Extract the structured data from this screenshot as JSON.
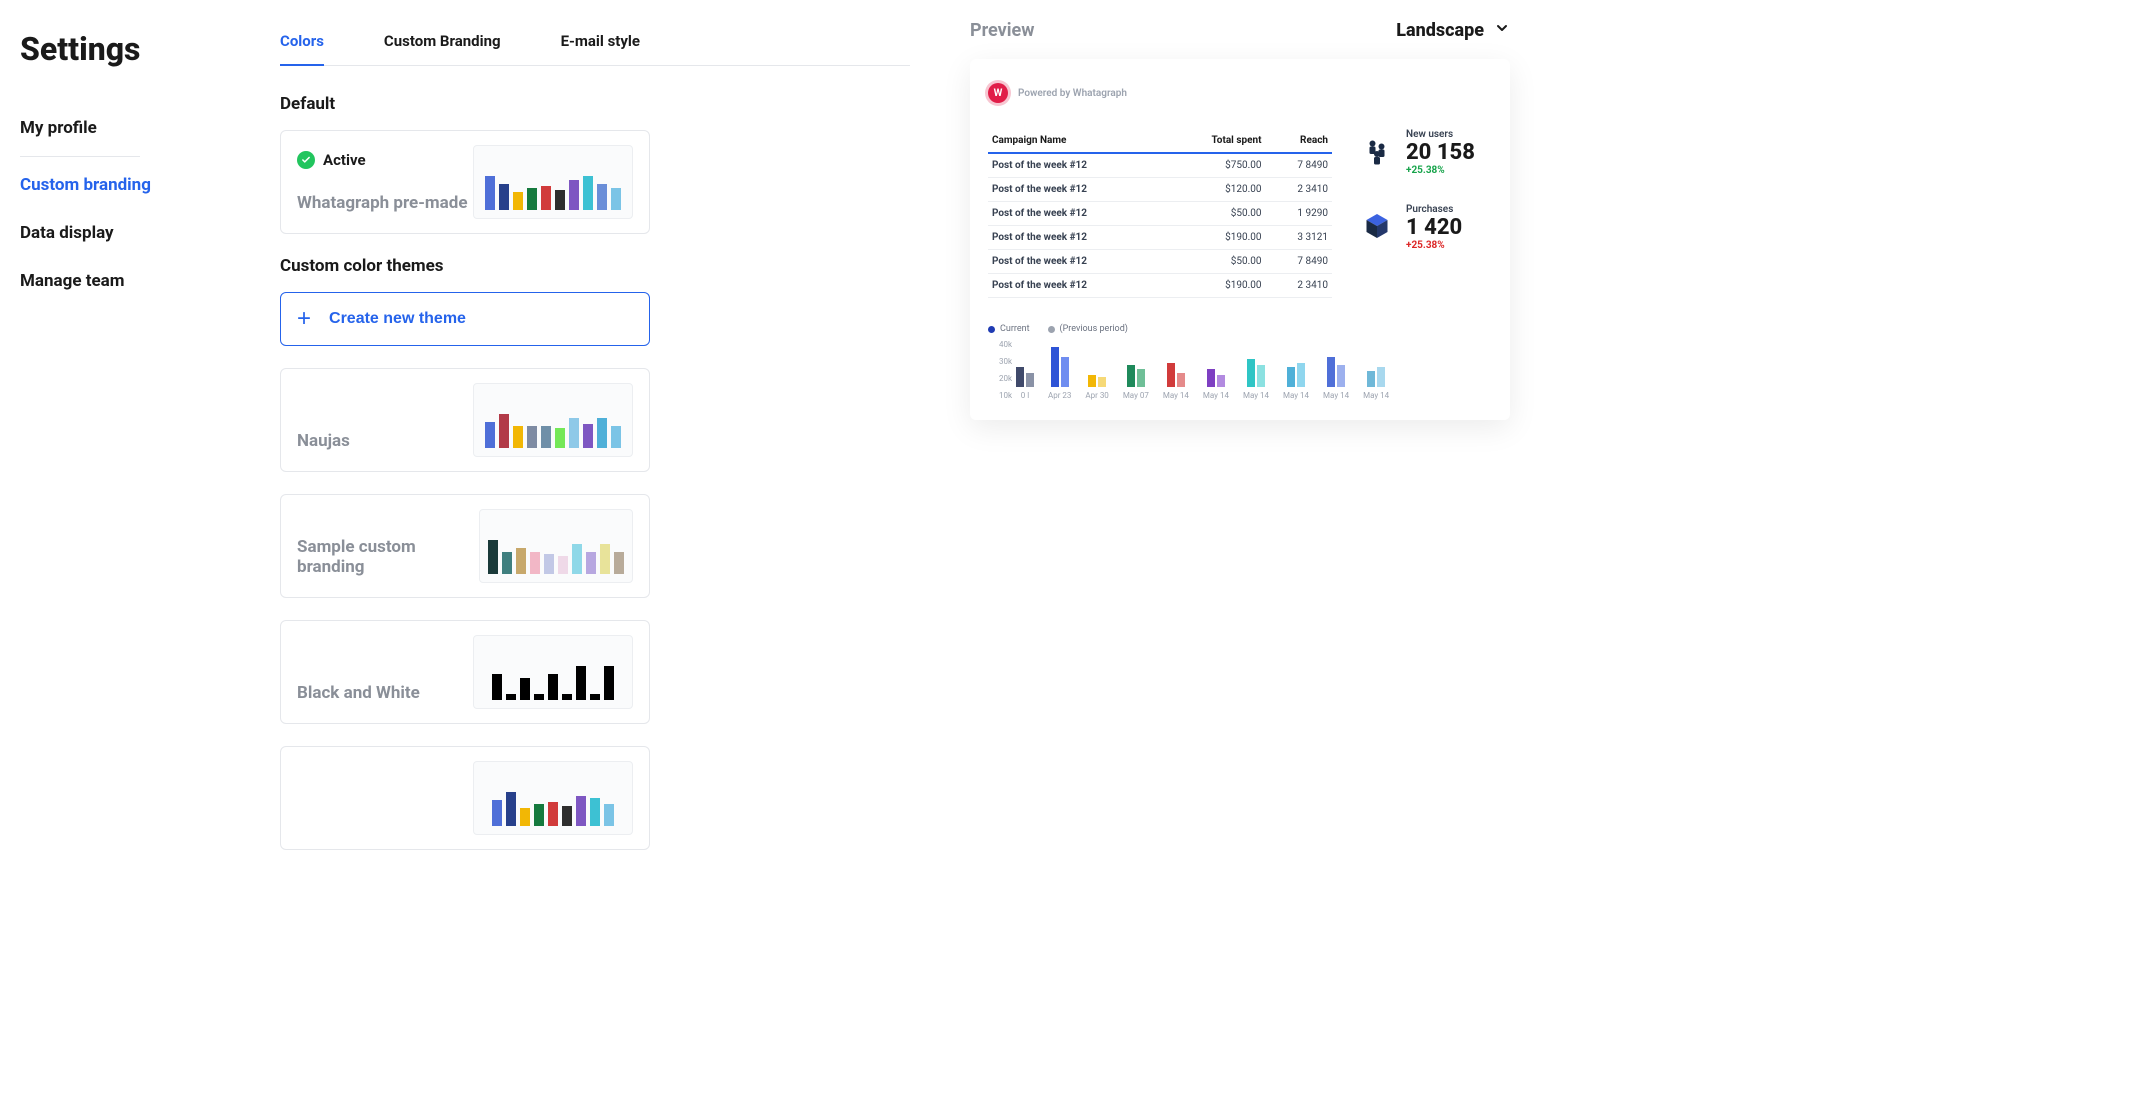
{
  "page_title": "Settings",
  "sidebar": {
    "items": [
      {
        "label": "My profile",
        "active": false
      },
      {
        "label": "Custom branding",
        "active": true
      },
      {
        "label": "Data display",
        "active": false
      },
      {
        "label": "Manage team",
        "active": false
      }
    ]
  },
  "tabs": [
    {
      "label": "Colors",
      "active": true
    },
    {
      "label": "Custom Branding",
      "active": false
    },
    {
      "label": "E-mail style",
      "active": false
    }
  ],
  "default_section_label": "Default",
  "active_badge_label": "Active",
  "default_theme": {
    "name": "Whatagraph pre-made",
    "is_active": true,
    "bars": [
      {
        "h": 34,
        "c": "#4f6fd8"
      },
      {
        "h": 26,
        "c": "#27408b"
      },
      {
        "h": 18,
        "c": "#f2b705"
      },
      {
        "h": 22,
        "c": "#157a3e"
      },
      {
        "h": 24,
        "c": "#d13b3b"
      },
      {
        "h": 20,
        "c": "#2e2e2e"
      },
      {
        "h": 30,
        "c": "#7e57c2"
      },
      {
        "h": 34,
        "c": "#3dc1d3"
      },
      {
        "h": 26,
        "c": "#6a8ed8"
      },
      {
        "h": 22,
        "c": "#7bc4e6"
      }
    ]
  },
  "custom_section_label": "Custom color themes",
  "create_btn_label": "Create new theme",
  "custom_themes": [
    {
      "name": "Naujas",
      "bars": [
        {
          "h": 26,
          "c": "#4f6fd8"
        },
        {
          "h": 34,
          "c": "#b23a48"
        },
        {
          "h": 22,
          "c": "#f2b705"
        },
        {
          "h": 22,
          "c": "#7e8ba3"
        },
        {
          "h": 22,
          "c": "#6f8fa8"
        },
        {
          "h": 20,
          "c": "#74e858"
        },
        {
          "h": 30,
          "c": "#8ec9e8"
        },
        {
          "h": 24,
          "c": "#7e57c2"
        },
        {
          "h": 30,
          "c": "#4fb0d8"
        },
        {
          "h": 22,
          "c": "#7bc4e6"
        }
      ]
    },
    {
      "name": "Sample custom branding",
      "bars": [
        {
          "h": 34,
          "c": "#1a3a3a"
        },
        {
          "h": 22,
          "c": "#3f7f7f"
        },
        {
          "h": 26,
          "c": "#c7a86b"
        },
        {
          "h": 22,
          "c": "#f2b7c6"
        },
        {
          "h": 20,
          "c": "#c2c8e6"
        },
        {
          "h": 18,
          "c": "#efd9e8"
        },
        {
          "h": 30,
          "c": "#8fd8e8"
        },
        {
          "h": 22,
          "c": "#b7a7e0"
        },
        {
          "h": 30,
          "c": "#e8e39a"
        },
        {
          "h": 22,
          "c": "#b8ab9a"
        }
      ]
    },
    {
      "name": "Black and White",
      "bars": [
        {
          "h": 26,
          "c": "#000000"
        },
        {
          "h": 6,
          "c": "#000000"
        },
        {
          "h": 22,
          "c": "#000000"
        },
        {
          "h": 6,
          "c": "#000000"
        },
        {
          "h": 26,
          "c": "#000000"
        },
        {
          "h": 6,
          "c": "#000000"
        },
        {
          "h": 34,
          "c": "#000000"
        },
        {
          "h": 6,
          "c": "#000000"
        },
        {
          "h": 34,
          "c": "#000000"
        }
      ]
    },
    {
      "name": "",
      "bars": [
        {
          "h": 26,
          "c": "#4f6fd8"
        },
        {
          "h": 34,
          "c": "#27408b"
        },
        {
          "h": 18,
          "c": "#f2b705"
        },
        {
          "h": 22,
          "c": "#157a3e"
        },
        {
          "h": 24,
          "c": "#d13b3b"
        },
        {
          "h": 20,
          "c": "#2e2e2e"
        },
        {
          "h": 30,
          "c": "#7e57c2"
        },
        {
          "h": 28,
          "c": "#3dc1d3"
        },
        {
          "h": 22,
          "c": "#7bc4e6"
        }
      ]
    }
  ],
  "preview": {
    "title": "Preview",
    "orientation": "Landscape",
    "brand_text": "Powered by Whatagraph",
    "brand_logo_letter": "W",
    "table": {
      "columns": [
        "Campaign Name",
        "Total spent",
        "Reach"
      ],
      "rows": [
        {
          "name": "Post of the week #12",
          "spent": "$750.00",
          "reach": "7 8490"
        },
        {
          "name": "Post of the week #12",
          "spent": "$120.00",
          "reach": "2 3410"
        },
        {
          "name": "Post of the week #12",
          "spent": "$50.00",
          "reach": "1 9290"
        },
        {
          "name": "Post of the week #12",
          "spent": "$190.00",
          "reach": "3 3121"
        },
        {
          "name": "Post of the week #12",
          "spent": "$50.00",
          "reach": "7 8490"
        },
        {
          "name": "Post of the week #12",
          "spent": "$190.00",
          "reach": "2 3410"
        }
      ]
    },
    "metrics": [
      {
        "label": "New users",
        "value": "20 158",
        "delta": "+25.38%",
        "dir": "up",
        "icon": "users"
      },
      {
        "label": "Purchases",
        "value": "1 420",
        "delta": "+25.38%",
        "dir": "down",
        "icon": "cube"
      }
    ],
    "legend": [
      {
        "label": "Current",
        "color": "#1f3bb3"
      },
      {
        "label": "(Previous period)",
        "color": "#9ca3af"
      }
    ],
    "mini_chart": {
      "y_ticks": [
        "40k",
        "30k",
        "20k",
        "10k"
      ],
      "groups": [
        {
          "x": "0 l",
          "bars": [
            {
              "h": 20,
              "c": "#404a6b"
            },
            {
              "h": 14,
              "c": "#8a92a6"
            }
          ]
        },
        {
          "x": "Apr 23",
          "bars": [
            {
              "h": 40,
              "c": "#2e54d6"
            },
            {
              "h": 30,
              "c": "#6f8df0"
            }
          ]
        },
        {
          "x": "Apr 30",
          "bars": [
            {
              "h": 12,
              "c": "#f2b705"
            },
            {
              "h": 10,
              "c": "#f6d977"
            }
          ]
        },
        {
          "x": "May 07",
          "bars": [
            {
              "h": 22,
              "c": "#1f8a5b"
            },
            {
              "h": 18,
              "c": "#6fbf97"
            }
          ]
        },
        {
          "x": "May 14",
          "bars": [
            {
              "h": 24,
              "c": "#d13b3b"
            },
            {
              "h": 14,
              "c": "#e58a8a"
            }
          ]
        },
        {
          "x": "May 14",
          "bars": [
            {
              "h": 18,
              "c": "#7e3fc2"
            },
            {
              "h": 12,
              "c": "#b28ae0"
            }
          ]
        },
        {
          "x": "May 14",
          "bars": [
            {
              "h": 28,
              "c": "#2fc5c5"
            },
            {
              "h": 22,
              "c": "#8be1e1"
            }
          ]
        },
        {
          "x": "May 14",
          "bars": [
            {
              "h": 20,
              "c": "#4fb0d8"
            },
            {
              "h": 24,
              "c": "#8fd6ee"
            }
          ]
        },
        {
          "x": "May 14",
          "bars": [
            {
              "h": 30,
              "c": "#4f6fd8"
            },
            {
              "h": 22,
              "c": "#9cb0ee"
            }
          ]
        },
        {
          "x": "May 14",
          "bars": [
            {
              "h": 16,
              "c": "#6fb8d8"
            },
            {
              "h": 20,
              "c": "#a8d8ee"
            }
          ]
        }
      ]
    }
  },
  "chart_data": {
    "type": "bar",
    "title": "",
    "xlabel": "",
    "ylabel": "",
    "ylim": [
      0,
      40000
    ],
    "y_ticks": [
      10000,
      20000,
      30000,
      40000
    ],
    "categories": [
      "0 l",
      "Apr 23",
      "Apr 30",
      "May 07",
      "May 14",
      "May 14",
      "May 14",
      "May 14",
      "May 14",
      "May 14"
    ],
    "series": [
      {
        "name": "Current",
        "color": "#1f3bb3",
        "values": [
          18000,
          38000,
          11000,
          20000,
          22000,
          16000,
          26000,
          18000,
          28000,
          15000
        ]
      },
      {
        "name": "(Previous period)",
        "color": "#9ca3af",
        "values": [
          13000,
          28000,
          9000,
          16000,
          13000,
          11000,
          20000,
          22000,
          20000,
          18000
        ]
      }
    ]
  }
}
